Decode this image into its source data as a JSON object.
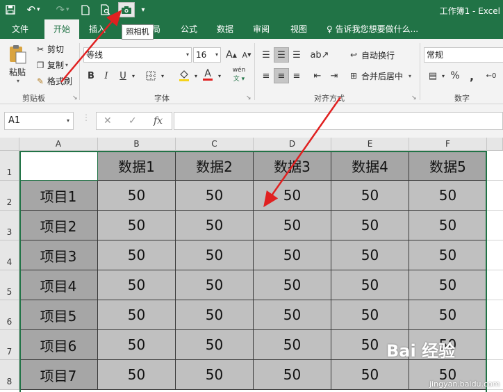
{
  "titlebar": {
    "title": "工作簿1 - Excel",
    "tooltip": "照相机"
  },
  "tabs": [
    {
      "label": "文件"
    },
    {
      "label": "开始"
    },
    {
      "label": "插入"
    },
    {
      "label": "局"
    },
    {
      "label": "公式"
    },
    {
      "label": "数据"
    },
    {
      "label": "审阅"
    },
    {
      "label": "视图"
    }
  ],
  "tell_me": "告诉我您想要做什么...",
  "clipboard": {
    "paste": "粘贴",
    "cut": "剪切",
    "copy": "复制",
    "format_painter": "格式刷",
    "group_label": "剪贴板"
  },
  "font": {
    "name": "等线",
    "size": "16",
    "bold": "B",
    "italic": "I",
    "underline": "U",
    "grow": "A",
    "shrink": "A",
    "color_glyph": "A",
    "phonetic": "wén",
    "group_label": "字体"
  },
  "alignment": {
    "wrap_text": "自动换行",
    "merge_center": "合并后居中",
    "group_label": "对齐方式"
  },
  "number": {
    "format": "常规",
    "percent": "%",
    "comma": ",",
    "group_label": "数字"
  },
  "formula_bar": {
    "name_box": "A1",
    "fx": "fx",
    "cancel": "✕",
    "enter": "✓",
    "value": ""
  },
  "columns": [
    "A",
    "B",
    "C",
    "D",
    "E",
    "F"
  ],
  "rows": [
    "1",
    "2",
    "3",
    "4",
    "5",
    "6",
    "7",
    "8"
  ],
  "table": {
    "headers": [
      "",
      "数据1",
      "数据2",
      "数据3",
      "数据4",
      "数据5"
    ],
    "items": [
      "项目1",
      "项目2",
      "项目3",
      "项目4",
      "项目5",
      "项目6",
      "项目7"
    ],
    "value": "50"
  },
  "watermark": {
    "brand": "Bai 经验",
    "url": "jingyan.baidu.com"
  },
  "colors": {
    "excel_green": "#217346",
    "header_fill": "#a6a6a6",
    "value_fill": "#c0c0c0",
    "arrow_red": "#e02020"
  }
}
